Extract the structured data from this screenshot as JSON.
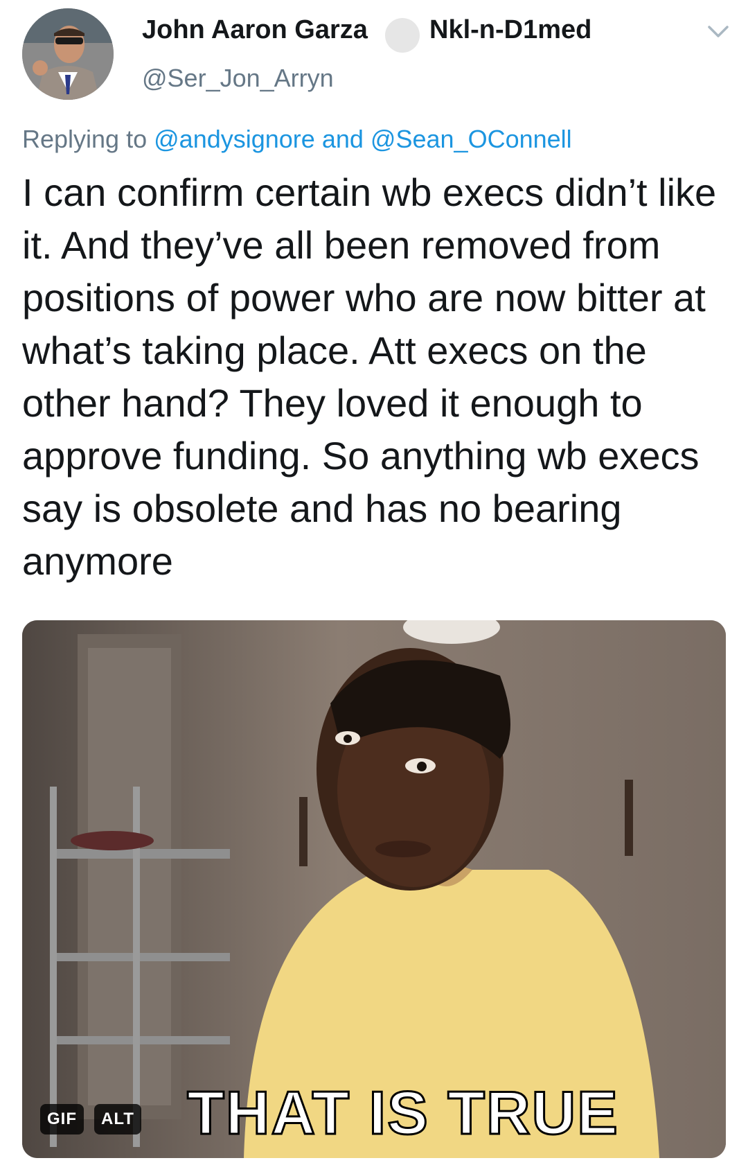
{
  "author": {
    "display_name": "John Aaron Garza",
    "name_suffix": "Nkl-n-D1med",
    "handle": "@Ser_Jon_Arryn",
    "avatar_icon": "profile-photo",
    "menu_icon": "chevron-down-icon"
  },
  "reply": {
    "prefix": "Replying to",
    "mention_1": "@andysignore",
    "conjunction": "and",
    "mention_2": "@Sean_OConnell"
  },
  "tweet": {
    "text": "I can confirm certain wb execs didn’t like it. And they’ve all been removed from positions of power who are now bitter at what’s taking place. Att execs on the other hand? They loved it enough to approve funding. So anything wb execs say is obsolete and has no bearing anymore"
  },
  "media": {
    "caption": "THAT IS TRUE",
    "gif_badge": "GIF",
    "alt_badge": "ALT"
  },
  "colors": {
    "text": "#14171a",
    "secondary": "#657786",
    "link": "#1b95e0"
  }
}
